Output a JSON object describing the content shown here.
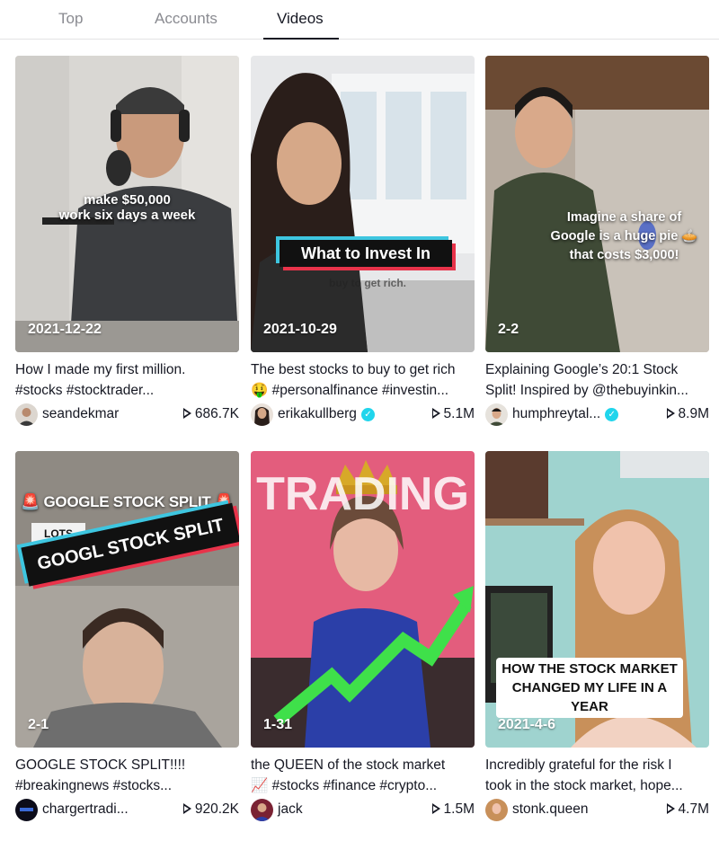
{
  "tabs": [
    {
      "label": "Top"
    },
    {
      "label": "Accounts"
    },
    {
      "label": "Videos"
    }
  ],
  "active_tab": "Videos",
  "videos": [
    {
      "overlay_lines": [
        "make $50,000",
        "work six days a week"
      ],
      "date": "2021-12-22",
      "desc_line1": "How I made my first million.",
      "desc_line2": "#stocks #stocktrader...",
      "author": "seandekmar",
      "verified": false,
      "views": "686.7K"
    },
    {
      "overlay_banner": "What to Invest In",
      "overlay_sub": "buy to get rich.",
      "date": "2021-10-29",
      "desc_line1": "The best stocks to buy to get rich",
      "desc_line2": "🤑 #personalfinance #investin...",
      "author": "erikakullberg",
      "verified": true,
      "views": "5.1M"
    },
    {
      "overlay_lines": [
        "Imagine a share of",
        "Google is a huge pie 🥧",
        "that costs $3,000!"
      ],
      "date": "2-2",
      "desc_line1": "Explaining Google’s 20:1 Stock",
      "desc_line2": "Split! Inspired by @thebuyinkin...",
      "author": "humphreytal...",
      "verified": true,
      "views": "8.9M"
    },
    {
      "overlay_top": "🚨 GOOGLE STOCK SPLIT 🚨",
      "overlay_lots": "LOTS",
      "overlay_banner": "GOOGL STOCK SPLIT",
      "date": "2-1",
      "desc_line1": "GOOGLE STOCK SPLIT!!!!",
      "desc_line2": "#breakingnews #stocks...",
      "author": "chargertradi...",
      "verified": false,
      "views": "920.2K"
    },
    {
      "overlay_title": "TRADING",
      "date": "1-31",
      "desc_line1": "the QUEEN of the stock market",
      "desc_line2": "📈 #stocks #finance #crypto...",
      "author": "jack",
      "verified": false,
      "views": "1.5M"
    },
    {
      "overlay_box": [
        "HOW THE STOCK MARKET",
        "CHANGED MY LIFE IN A",
        "YEAR"
      ],
      "date": "2021-4-6",
      "desc_line1": "Incredibly grateful for the risk I",
      "desc_line2": "took in the stock market, hope...",
      "author": "stonk.queen",
      "verified": false,
      "views": "4.7M"
    }
  ],
  "colors": {
    "text": "#161823",
    "muted_tab": "#8a8b91",
    "verified": "#20d5ec",
    "banner_cyan": "#3ec6e0",
    "banner_red": "#e8334a"
  },
  "icons": [
    "play-icon",
    "verified-icon"
  ]
}
